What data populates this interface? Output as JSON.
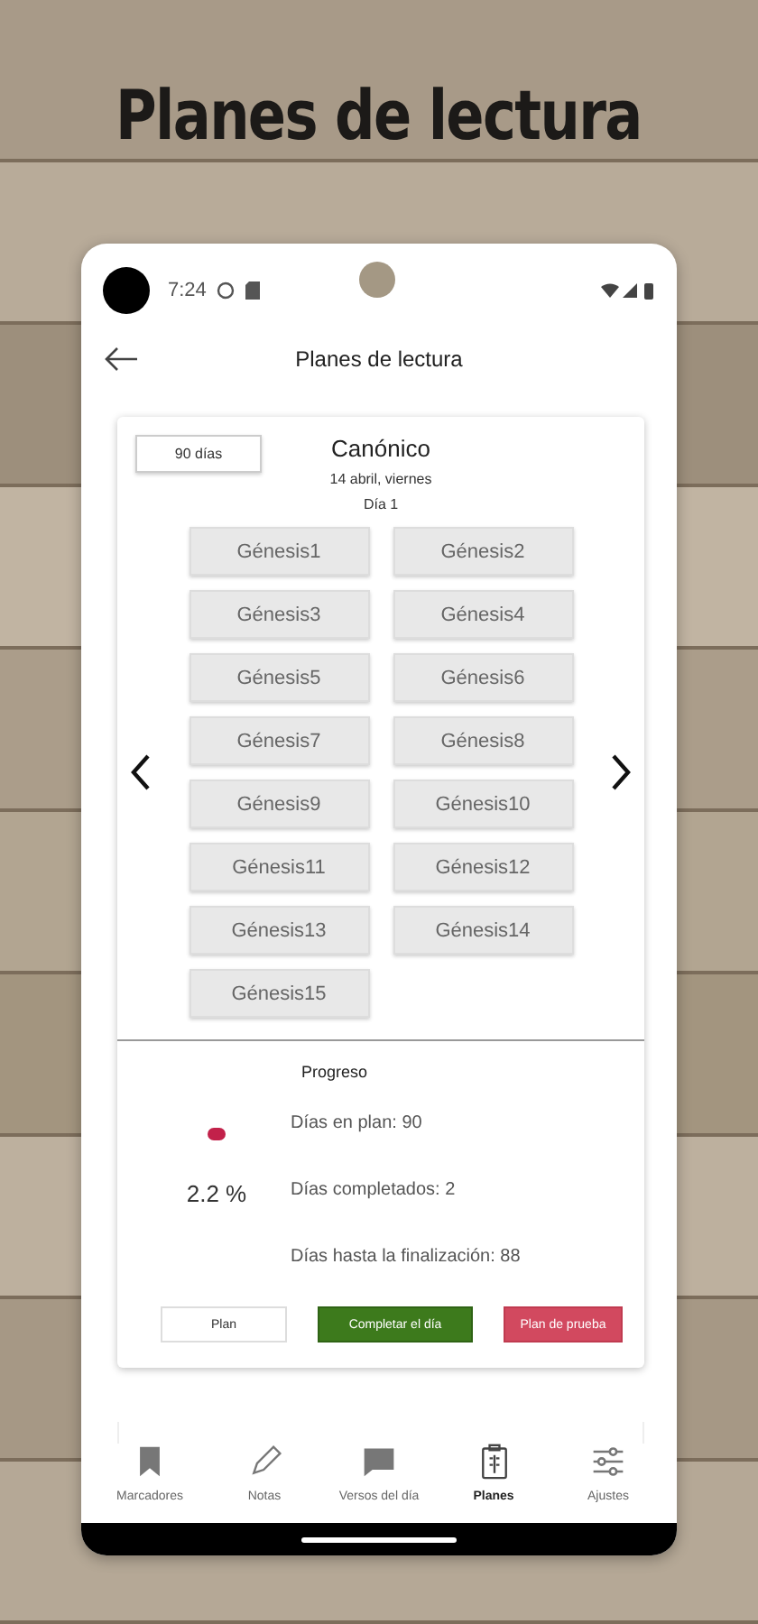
{
  "page_title": "Planes de lectura",
  "status_bar": {
    "time": "7:24"
  },
  "app_bar": {
    "title": "Planes de lectura"
  },
  "plan": {
    "duration": "90 días",
    "name": "Canónico",
    "date": "14 abril, viernes",
    "day": "Día 1",
    "readings": [
      "Génesis1",
      "Génesis2",
      "Génesis3",
      "Génesis4",
      "Génesis5",
      "Génesis6",
      "Génesis7",
      "Génesis8",
      "Génesis9",
      "Génesis10",
      "Génesis11",
      "Génesis12",
      "Génesis13",
      "Génesis14",
      "Génesis15"
    ]
  },
  "progress": {
    "title": "Progreso",
    "percent": "2.2 %",
    "stats": [
      "Días en plan: 90",
      "Días completados: 2",
      "Días hasta la finalización: 88"
    ]
  },
  "actions": [
    {
      "label": "Plan",
      "kind": "outline"
    },
    {
      "label": "Completar el día",
      "kind": "primary"
    },
    {
      "label": "Plan de prueba",
      "kind": "danger"
    }
  ],
  "nav": [
    {
      "label": "Marcadores",
      "selected": false
    },
    {
      "label": "Notas",
      "selected": false
    },
    {
      "label": "Versos del día",
      "selected": false
    },
    {
      "label": "Planes",
      "selected": true
    },
    {
      "label": "Ajustes",
      "selected": false
    }
  ]
}
